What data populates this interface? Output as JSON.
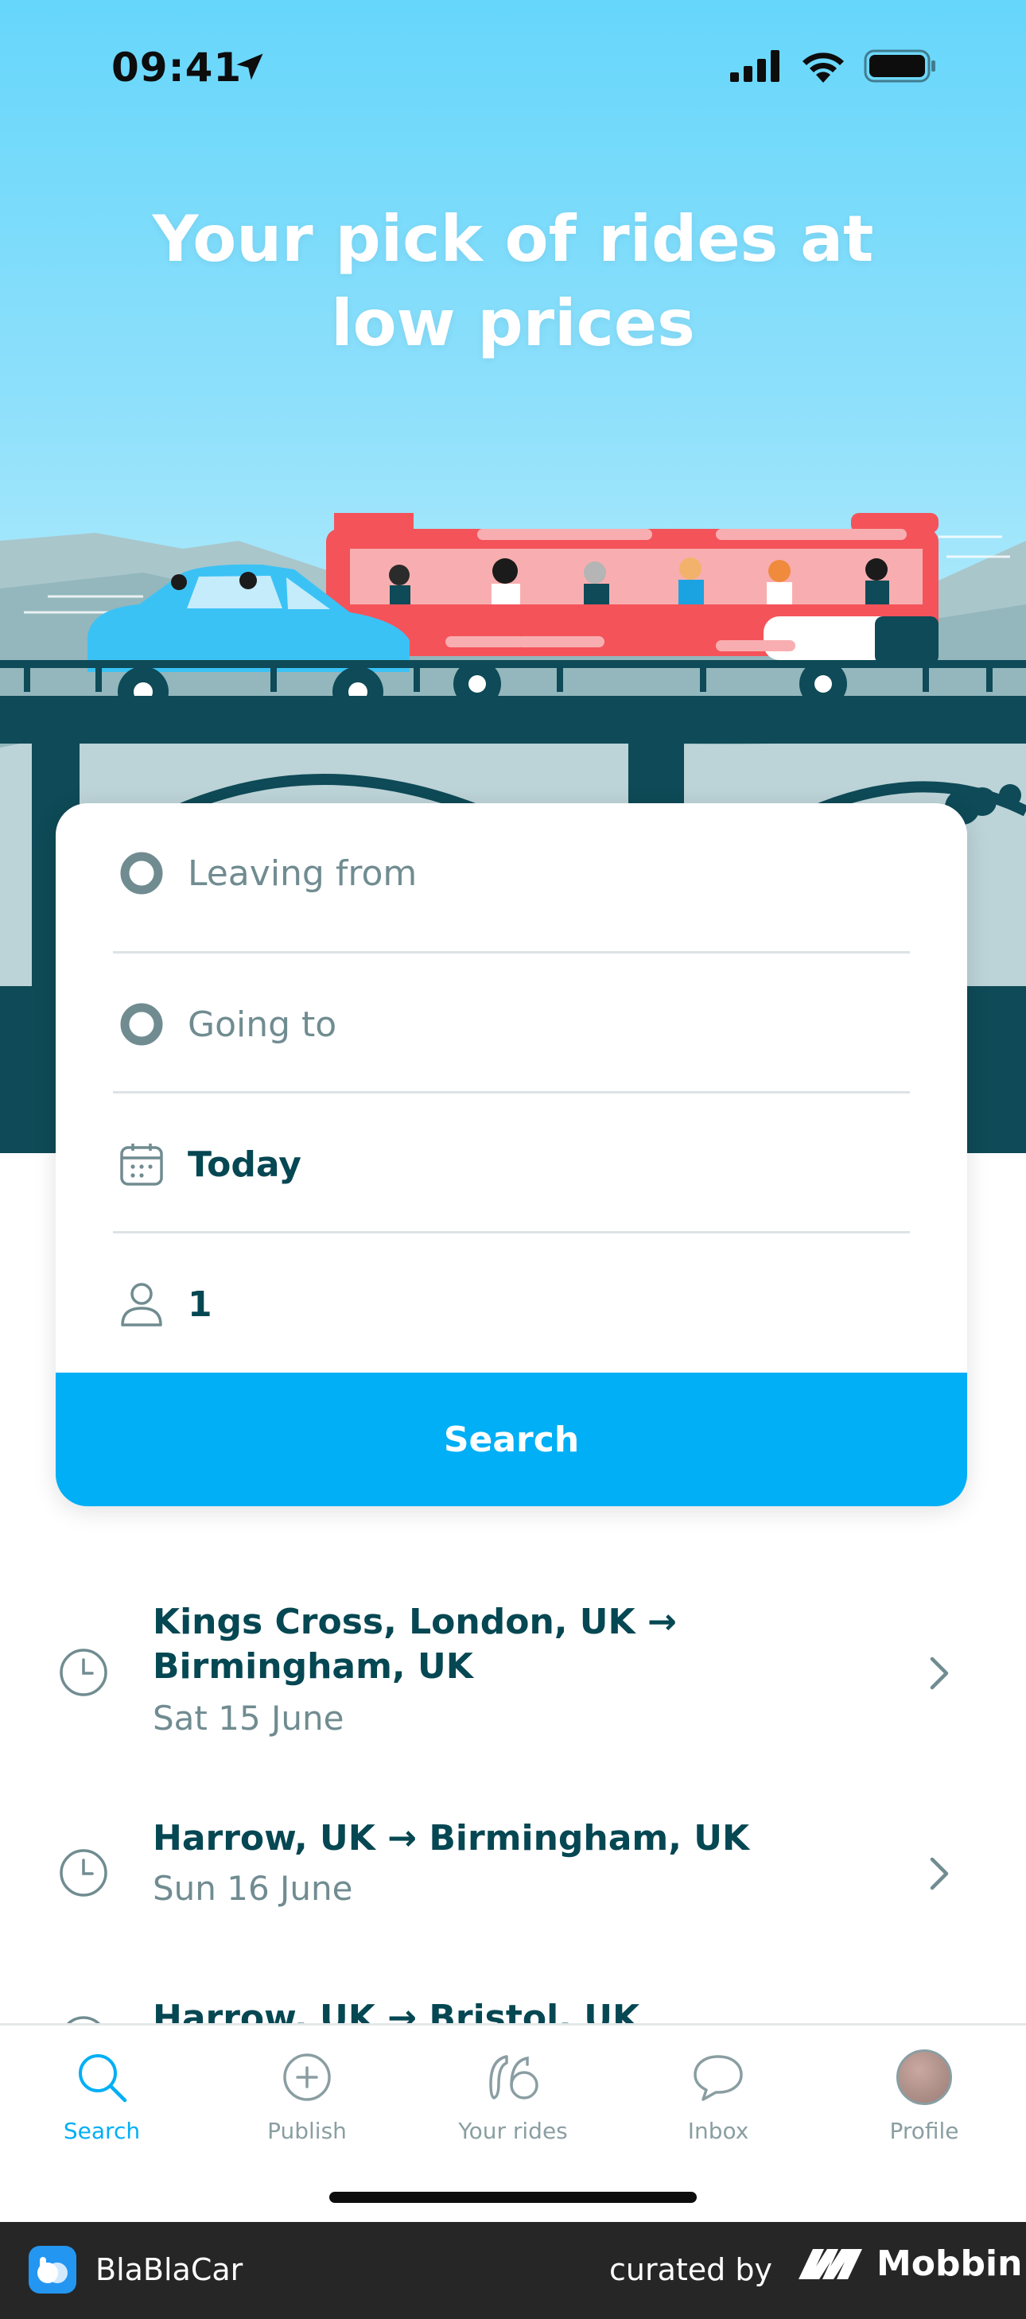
{
  "status_bar": {
    "time": "09:41"
  },
  "hero": {
    "title_line1": "Your pick of rides at",
    "title_line2": "low prices"
  },
  "search_form": {
    "leaving_from_placeholder": "Leaving from",
    "going_to_placeholder": "Going to",
    "date_value": "Today",
    "passengers_value": "1",
    "search_label": "Search"
  },
  "recent_searches": [
    {
      "route_line1": "Kings Cross, London, UK →",
      "route_line2": "Birmingham, UK",
      "date": "Sat 15 June"
    },
    {
      "route_line1": "Harrow, UK → Birmingham, UK",
      "route_line2": "",
      "date": "Sun 16 June"
    },
    {
      "route_line1": "Harrow, UK → Bristol, UK",
      "route_line2": "",
      "date": ""
    }
  ],
  "tab_bar": {
    "tabs": [
      {
        "label": "Search",
        "icon": "search-icon",
        "active": true
      },
      {
        "label": "Publish",
        "icon": "plus-circle-icon",
        "active": false
      },
      {
        "label": "Your rides",
        "icon": "rides-icon",
        "active": false
      },
      {
        "label": "Inbox",
        "icon": "chat-icon",
        "active": false
      },
      {
        "label": "Profile",
        "icon": "avatar",
        "active": false
      }
    ]
  },
  "footer": {
    "app_name": "BlaBlaCar",
    "curated_by": "curated by",
    "brand": "Mobbin"
  },
  "colors": {
    "accent": "#00aff5",
    "text_dark": "#054752",
    "text_muted": "#708c91",
    "bus_red": "#f4535a",
    "car_blue": "#3bc2f5"
  }
}
